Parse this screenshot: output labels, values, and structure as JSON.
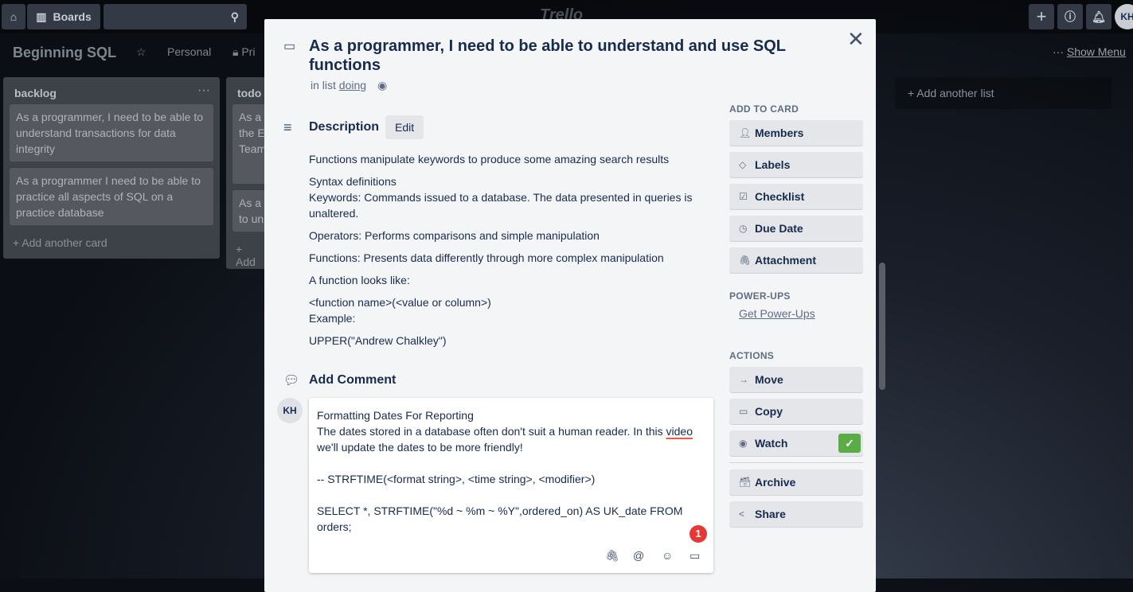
{
  "topbar": {
    "home_icon": "home-icon",
    "boards_label": "Boards",
    "search_placeholder": "",
    "logo": "Trello",
    "avatar": "KH"
  },
  "board": {
    "title": "Beginning SQL",
    "team": "Personal",
    "visibility": "Pri",
    "show_menu": "Show Menu",
    "add_list": "+ Add another list"
  },
  "lists": [
    {
      "title": "backlog",
      "cards": [
        "As a programmer, I need to be able to understand transactions for data integrity",
        "As a programmer I need to be able to practice all aspects of SQL on a practice database"
      ],
      "add": "+ Add another card"
    },
    {
      "title": "todo",
      "cards": [
        "As a\nthe E\nTeam",
        "As a\nto un"
      ],
      "add": "+ Add"
    }
  ],
  "card": {
    "title": "As a programmer, I need to be able to understand and use SQL functions",
    "in_list_prefix": "in list",
    "list_name": "doing",
    "description_heading": "Description",
    "edit_label": "Edit",
    "description": [
      "Functions manipulate keywords to produce some amazing search results",
      "Syntax definitions\nKeywords: Commands issued to a database. The data presented in queries is unaltered.",
      "Operators: Performs comparisons and simple manipulation",
      "Functions: Presents data differently through more complex manipulation",
      "A function looks like:",
      "<function name>(<value or column>)\nExample:",
      "UPPER(\"Andrew Chalkley\")"
    ],
    "comment_heading": "Add Comment",
    "comment_avatar": "KH",
    "comment_lines": [
      "Formatting Dates For Reporting",
      "The dates stored in a database often don't suit a human reader. In this ",
      "video",
      "we'll update the dates to be more friendly!",
      "",
      "-- STRFTIME(<format string>, <time string>, <modifier>)",
      "",
      "SELECT *, STRFTIME(\"%d ~  %m ~  %Y\",ordered_on) AS UK_date FROM orders;"
    ],
    "badge": "1"
  },
  "sidebar": {
    "add_to_card": "ADD TO CARD",
    "add_buttons": [
      "Members",
      "Labels",
      "Checklist",
      "Due Date",
      "Attachment"
    ],
    "power_ups": "POWER-UPS",
    "get_power_ups": "Get Power-Ups",
    "actions": "ACTIONS",
    "action_buttons": [
      "Move",
      "Copy",
      "Watch",
      "Archive",
      "Share"
    ],
    "watch_checked": true,
    "colors": {
      "watch_check": "#5aac44",
      "badge": "#e53935"
    }
  }
}
